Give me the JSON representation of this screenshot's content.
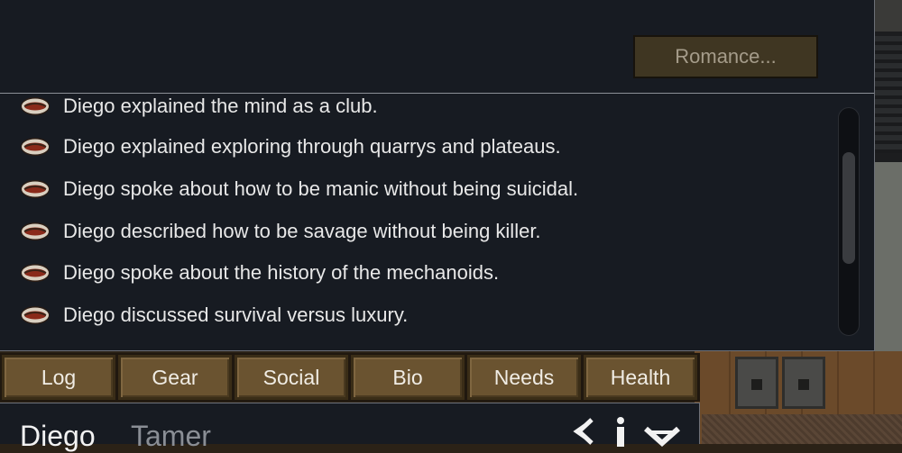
{
  "social": {
    "romance_label": "Romance..."
  },
  "log": {
    "partial_entry": "Diego explained the mind as a club.",
    "entries": [
      "Diego explained exploring through quarrys and plateaus.",
      "Diego spoke about how to be manic without being suicidal.",
      "Diego described how to be savage without being killer.",
      "Diego spoke about the history of the mechanoids.",
      "Diego discussed survival versus luxury."
    ],
    "entry_icon": "chat-mouth-icon"
  },
  "tabs": [
    "Log",
    "Gear",
    "Social",
    "Bio",
    "Needs",
    "Health"
  ],
  "inspect": {
    "name": "Diego",
    "title": "Tamer",
    "icons": [
      "rename-icon",
      "info-icon",
      "collapse-icon"
    ]
  },
  "colors": {
    "panel_bg": "#171b22",
    "tab_bg": "#6a5330",
    "button_bg": "#3f3622",
    "text": "#e8e8e8",
    "muted_text": "#8a8e95"
  }
}
